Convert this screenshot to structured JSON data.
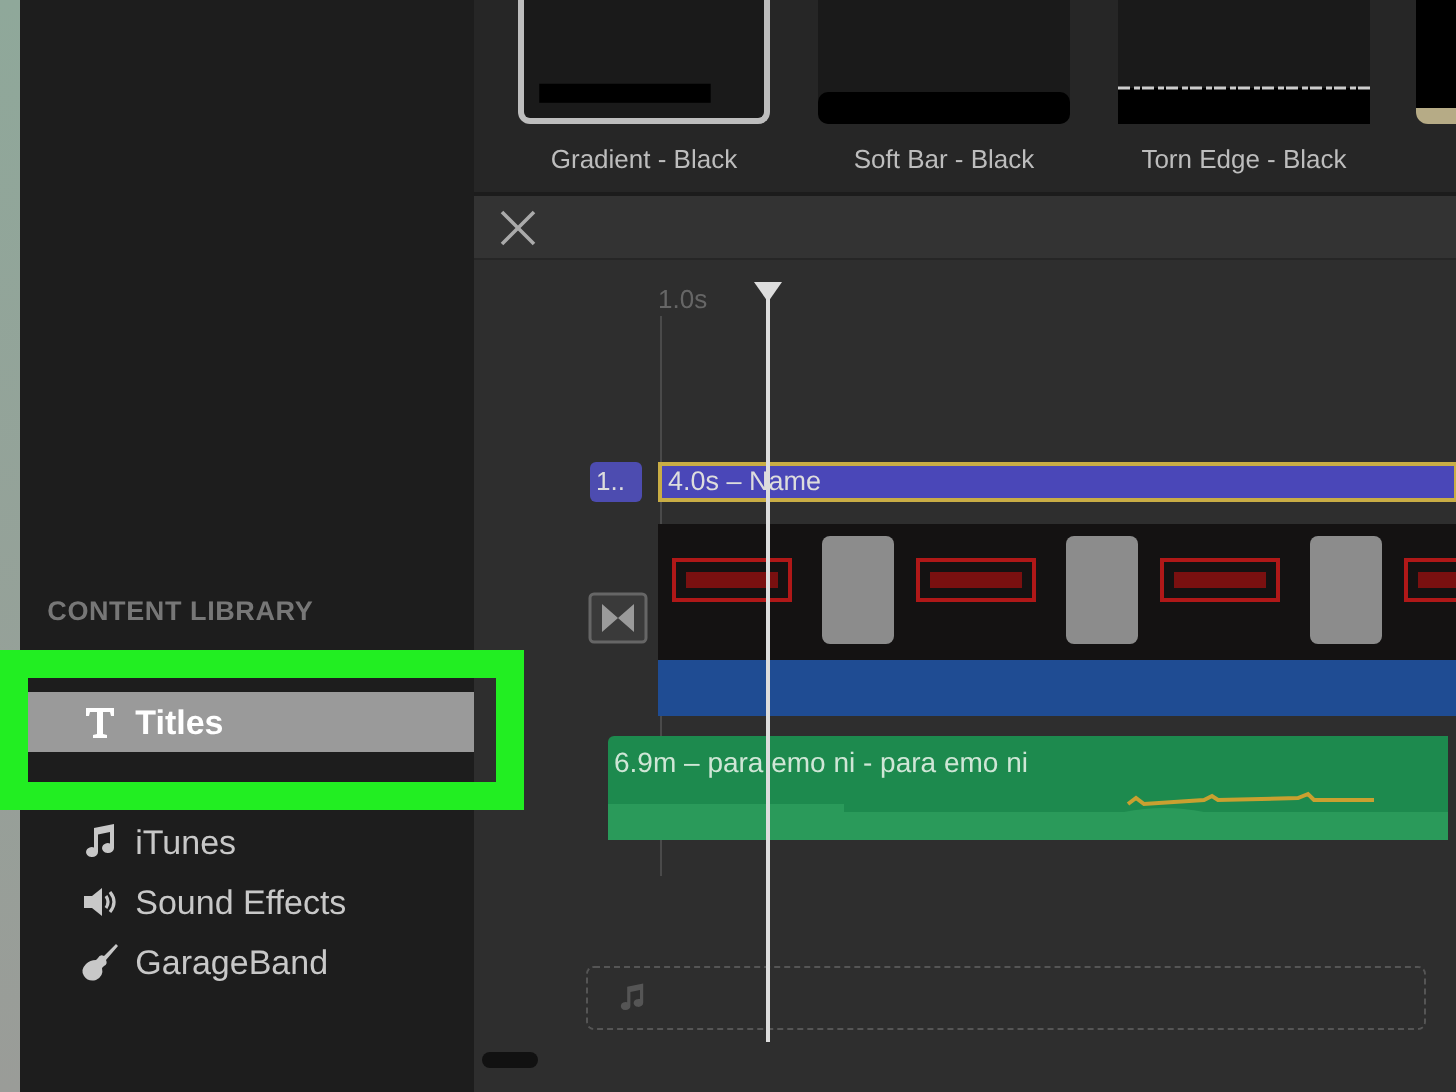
{
  "title_browser": {
    "items": [
      {
        "label": "Gradient - Black",
        "kind": "gradient",
        "selected": true
      },
      {
        "label": "Soft Bar - Black",
        "kind": "softbar",
        "selected": false
      },
      {
        "label": "Torn Edge - Black",
        "kind": "torn",
        "selected": false
      }
    ]
  },
  "sidebar": {
    "heading": "CONTENT LIBRARY",
    "items": [
      {
        "label": "Titles",
        "kind": "titles",
        "selected": true
      },
      {
        "label": "iTunes",
        "kind": "itunes",
        "selected": false
      },
      {
        "label": "Sound Effects",
        "kind": "sound",
        "selected": false
      },
      {
        "label": "GarageBand",
        "kind": "garageband",
        "selected": false
      }
    ]
  },
  "timeline": {
    "ruler_tick": "1.0s",
    "title_clip": {
      "badge": "1..",
      "label": "4.0s – Name"
    },
    "audio_clip": {
      "label": "6.9m – para emo ni - para emo ni"
    }
  }
}
